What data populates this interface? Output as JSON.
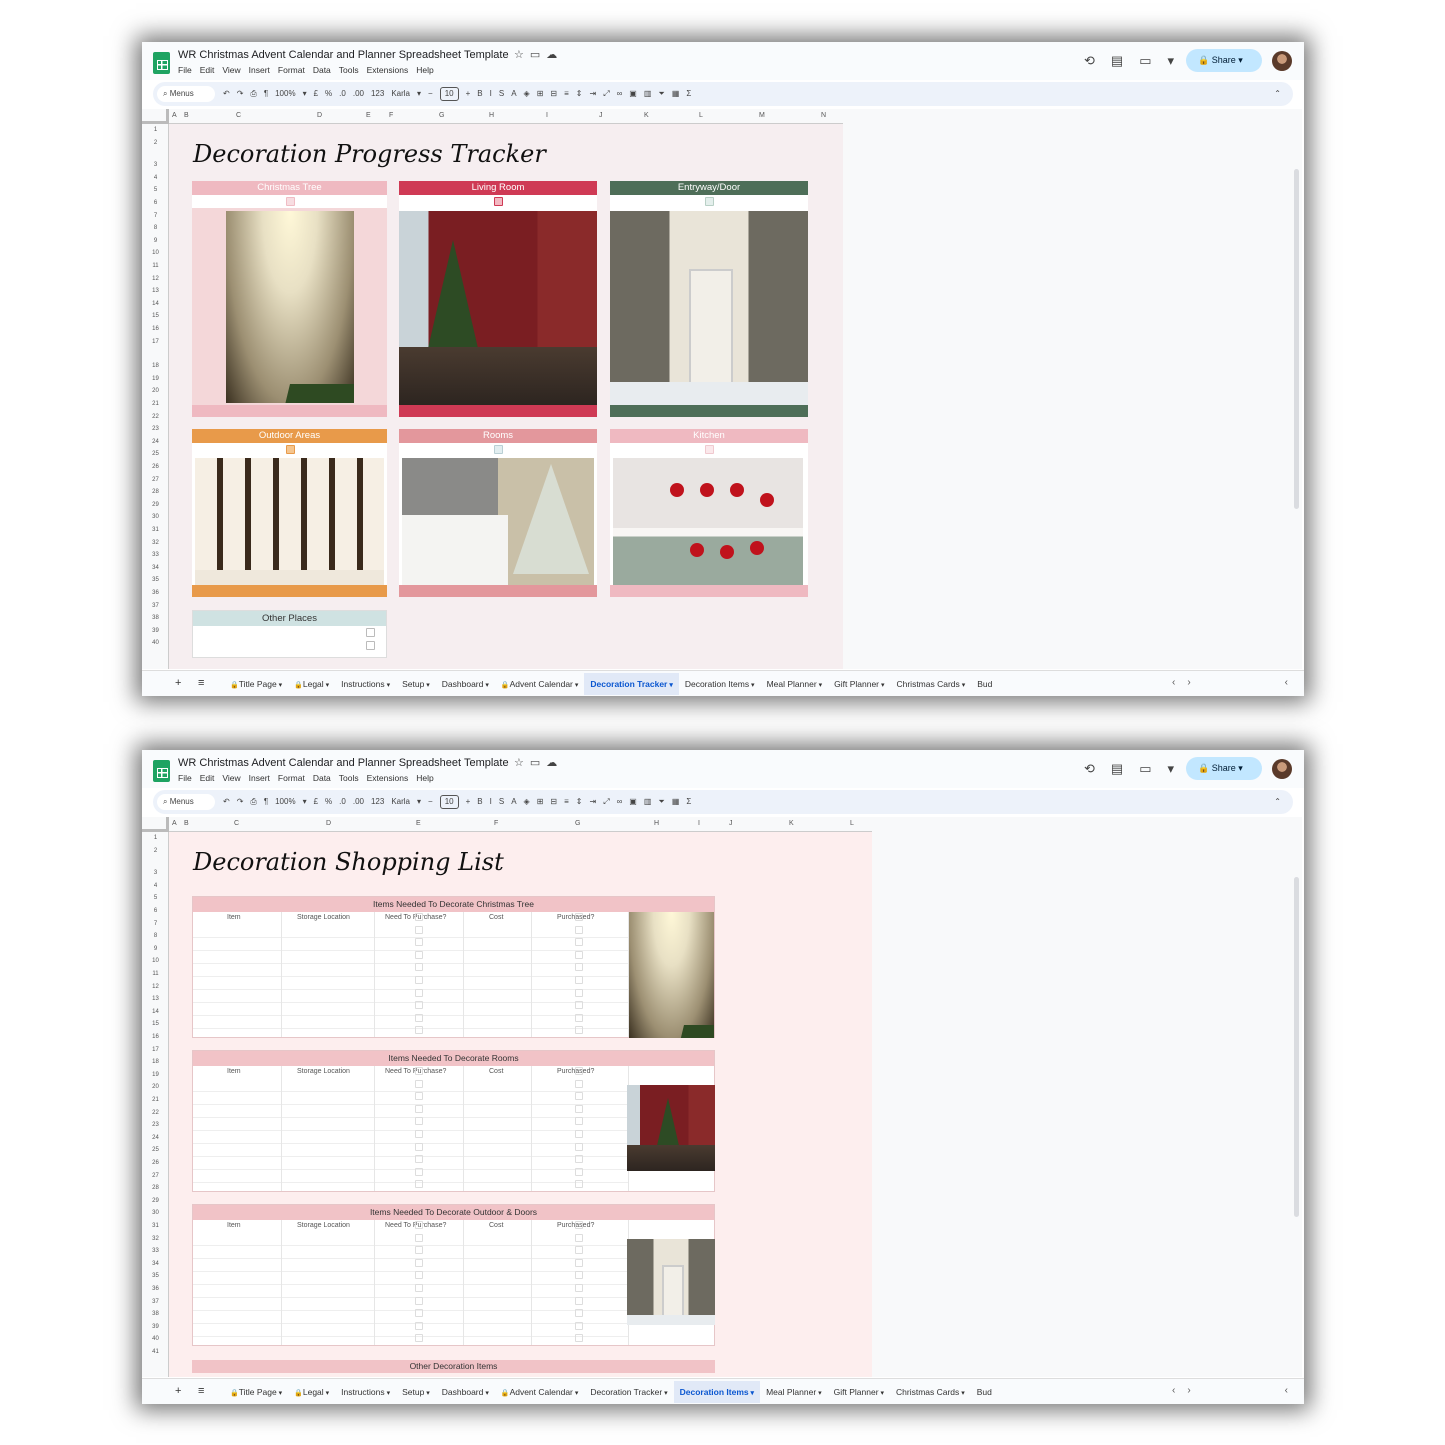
{
  "window": {
    "doc_title": "WR Christmas Advent Calendar and Planner Spreadsheet Template",
    "title_icons": [
      "star-icon",
      "folder-icon",
      "cloud-icon"
    ],
    "menus": [
      "File",
      "Edit",
      "View",
      "Insert",
      "Format",
      "Data",
      "Tools",
      "Extensions",
      "Help"
    ],
    "share_label": "Share",
    "toolbar": {
      "search_label": "Menus",
      "zoom": "100%",
      "currency": "£",
      "percent": "%",
      "dec_less": ".0",
      "dec_more": ".00",
      "number_format": "123",
      "font": "Karla",
      "font_size": "10",
      "bold": "B",
      "italic": "I",
      "strike": "S",
      "text_color": "A",
      "sum": "Σ"
    },
    "tabs": [
      "Title Page",
      "Legal",
      "Instructions",
      "Setup",
      "Dashboard",
      "Advent Calendar",
      "Decoration Tracker",
      "Decoration Items",
      "Meal Planner",
      "Gift Planner",
      "Christmas Cards",
      "Bud"
    ],
    "locked_tabs": [
      "Title Page",
      "Legal",
      "Advent Calendar"
    ]
  },
  "tracker": {
    "columns": [
      "A",
      "B",
      "C",
      "D",
      "E",
      "F",
      "G",
      "H",
      "I",
      "J",
      "K",
      "L",
      "M",
      "N"
    ],
    "rows": [
      "1",
      "2",
      "3",
      "4",
      "5",
      "6",
      "7",
      "8",
      "9",
      "10",
      "11",
      "12",
      "13",
      "14",
      "15",
      "16",
      "17",
      "18",
      "19",
      "20",
      "21",
      "22",
      "23",
      "24",
      "25",
      "26",
      "27",
      "28",
      "29",
      "30",
      "31",
      "32",
      "33",
      "34",
      "35",
      "36",
      "37",
      "38",
      "39",
      "40"
    ],
    "title": "Decoration Progress Tracker",
    "active_tab": "Decoration Tracker",
    "cards": [
      {
        "label": "Christmas Tree",
        "color": "#efb9c1",
        "photo": "christmas-tree-photo"
      },
      {
        "label": "Living Room",
        "color": "#cf3a55",
        "photo": "living-room-photo"
      },
      {
        "label": "Entryway/Door",
        "color": "#4e6e58",
        "photo": "entryway-door-photo"
      },
      {
        "label": "Outdoor Areas",
        "color": "#e89a4a",
        "photo": "outdoor-areas-photo"
      },
      {
        "label": "Rooms",
        "color": "#e3979c",
        "photo": "bedroom-photo"
      },
      {
        "label": "Kitchen",
        "color": "#efb9c1",
        "photo": "kitchen-photo"
      }
    ],
    "other_places": "Other Places"
  },
  "shopping": {
    "columns": [
      "A",
      "B",
      "C",
      "D",
      "E",
      "F",
      "G",
      "H",
      "I",
      "J",
      "K",
      "L"
    ],
    "rows": [
      "1",
      "2",
      "3",
      "4",
      "5",
      "6",
      "7",
      "8",
      "9",
      "10",
      "11",
      "12",
      "13",
      "14",
      "15",
      "16",
      "17",
      "18",
      "19",
      "20",
      "21",
      "22",
      "23",
      "24",
      "25",
      "26",
      "27",
      "28",
      "29",
      "30",
      "31",
      "32",
      "33",
      "34",
      "35",
      "36",
      "37",
      "38",
      "39",
      "40",
      "41"
    ],
    "title": "Decoration Shopping List",
    "active_tab": "Decoration Items",
    "column_headers": [
      "Item",
      "Storage Location",
      "Need To Purchase?",
      "Cost",
      "Purchased?"
    ],
    "sections": [
      {
        "title": "Items Needed To Decorate Christmas Tree",
        "photo": "christmas-tree-photo"
      },
      {
        "title": "Items Needed To Decorate Rooms",
        "photo": "living-room-photo"
      },
      {
        "title": "Items Needed To Decorate Outdoor & Doors",
        "photo": "entryway-door-photo"
      }
    ],
    "last_section": "Other Decoration Items"
  }
}
